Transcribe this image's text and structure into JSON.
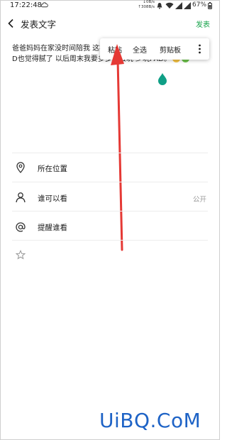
{
  "status_bar": {
    "time": "17:22:48",
    "net_down": "↓0B/s",
    "net_up": "↑308B/s",
    "battery": "67%"
  },
  "header": {
    "title": "发表文字",
    "publish_label": "发表"
  },
  "post": {
    "text": "爸爸妈妈在家没时间陪我 这样的生活我都觉得腻了我现在的PAD也觉得腻了 以后周末我要多多出去玩 少玩PAD。"
  },
  "context_menu": {
    "items": [
      "粘贴",
      "全选",
      "剪贴板"
    ]
  },
  "options": {
    "location_label": "所在位置",
    "visibility_label": "谁可以看",
    "visibility_value": "公开",
    "mention_label": "提醒谁看"
  },
  "watermark": "UiBQ.CoM",
  "colors": {
    "accent_green": "#16a34a",
    "annotation_red": "#e53935",
    "watermark_blue": "#1e63c6"
  }
}
